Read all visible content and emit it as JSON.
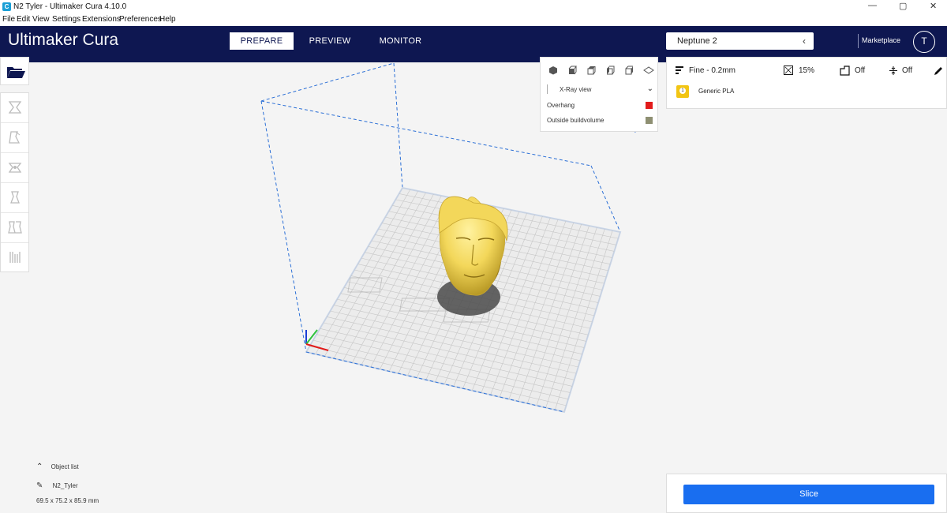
{
  "window": {
    "title": "N2 Tyler - Ultimaker Cura 4.10.0",
    "app_icon_letter": "C",
    "minimize": "—",
    "maximize": "▢",
    "close": "✕"
  },
  "menu": [
    "File",
    "Edit",
    "View",
    "Settings",
    "Extensions",
    "Preferences",
    "Help"
  ],
  "header": {
    "brand_bold": "Ultimaker",
    "brand_light": " Cura",
    "tabs": [
      {
        "label": "PREPARE",
        "active": true
      },
      {
        "label": "PREVIEW",
        "active": false
      },
      {
        "label": "MONITOR",
        "active": false
      }
    ],
    "printer": "Neptune 2",
    "marketplace": "Marketplace",
    "avatar_letter": "T"
  },
  "view_panel": {
    "view_mode": "X-Ray view",
    "legend": [
      {
        "label": "Overhang",
        "color": "#e21b1b"
      },
      {
        "label": "Outside buildvolume",
        "color": "#8e8f72"
      }
    ]
  },
  "settings": {
    "profile": "Fine - 0.2mm",
    "infill": "15%",
    "support": "Off",
    "adhesion": "Off",
    "material_slot": "1",
    "material": "Generic PLA"
  },
  "objects": {
    "header": "Object list",
    "name": "N2_Tyler",
    "dimensions": "69.5 x 75.2 x 85.9 mm"
  },
  "slice": {
    "label": "Slice"
  },
  "colors": {
    "header_bg": "#0e1751",
    "accent": "#196ef0",
    "model": "#f3d75a",
    "build_outline": "#2b6fd6"
  }
}
